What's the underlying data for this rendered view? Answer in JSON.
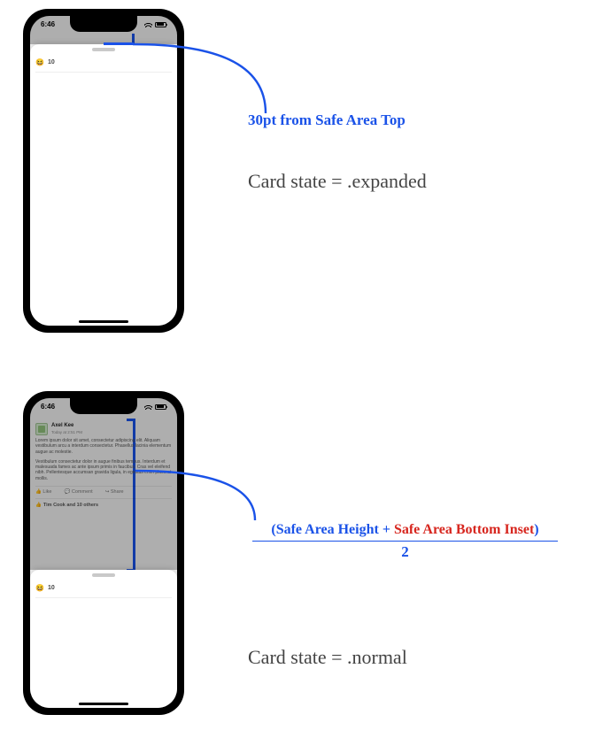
{
  "status": {
    "time": "6:46"
  },
  "post": {
    "author": "Axel Kee",
    "timestamp": "Today at 2:51 PM",
    "paragraph1": "Lorem ipsum dolor sit amet, consectetur adipiscing elit. Aliquam vestibulum arcu a interdum consectetur. Phasellus lacinia elementum augue ac molestie.",
    "paragraph2": "Vestibulum consectetur dolor in augue finibus tempus. Interdum et malesuada fames ac ante ipsum primis in faucibus. Cras vel eleifend nibh. Pellentesque accumsan gravida ligula, in egestas enim placerat mollis.",
    "like_label": "Like",
    "comment_label": "Comment",
    "share_label": "Share",
    "others_line": "Tim Cook and 10 others"
  },
  "card": {
    "count": "10"
  },
  "annotations": {
    "top_offset": "30pt from Safe Area Top",
    "state_expanded": "Card state = .expanded",
    "state_normal": "Card state = .normal",
    "formula_left": "(Safe Area Height + ",
    "formula_right_red": "Safe Area Bottom Inset",
    "formula_close": ")",
    "formula_denominator": "2"
  }
}
